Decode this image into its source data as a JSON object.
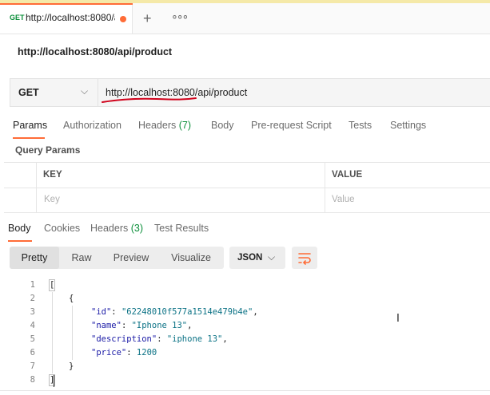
{
  "tab": {
    "method": "GET",
    "title": "http://localhost:8080/a",
    "new_tab_glyph": "+",
    "more_glyph": "∘∘∘"
  },
  "breadcrumb": "http://localhost:8080/api/product",
  "request": {
    "method": "GET",
    "url": "http://localhost:8080/api/product"
  },
  "request_tabs": [
    {
      "label": "Params"
    },
    {
      "label": "Authorization"
    },
    {
      "label": "Headers",
      "count": "(7)"
    },
    {
      "label": "Body"
    },
    {
      "label": "Pre-request Script"
    },
    {
      "label": "Tests"
    },
    {
      "label": "Settings"
    }
  ],
  "query_params": {
    "title": "Query Params",
    "headers": [
      "KEY",
      "VALUE"
    ],
    "placeholders": [
      "Key",
      "Value"
    ]
  },
  "response_tabs": [
    {
      "label": "Body"
    },
    {
      "label": "Cookies"
    },
    {
      "label": "Headers",
      "count": "(3)"
    },
    {
      "label": "Test Results"
    }
  ],
  "format": {
    "options": [
      "Pretty",
      "Raw",
      "Preview",
      "Visualize"
    ],
    "selected": "Pretty",
    "language": "JSON"
  },
  "response_body": {
    "line_numbers": [
      "1",
      "2",
      "3",
      "4",
      "5",
      "6",
      "7",
      "8"
    ],
    "open_bracket": "[",
    "open_brace": "{",
    "close_brace": "}",
    "close_bracket": "]",
    "fields": [
      {
        "key": "\"id\"",
        "value": "\"62248010f577a1514e479b4e\"",
        "sep": ","
      },
      {
        "key": "\"name\"",
        "value": "\"Iphone 13\"",
        "sep": ","
      },
      {
        "key": "\"description\"",
        "value": "\"iphone 13\"",
        "sep": ","
      },
      {
        "key": "\"price\"",
        "value": "1200",
        "sep": ""
      }
    ]
  },
  "colors": {
    "accent": "#ff6c37",
    "get_method": "#0c8f3a",
    "annotation": "#d0021b"
  }
}
